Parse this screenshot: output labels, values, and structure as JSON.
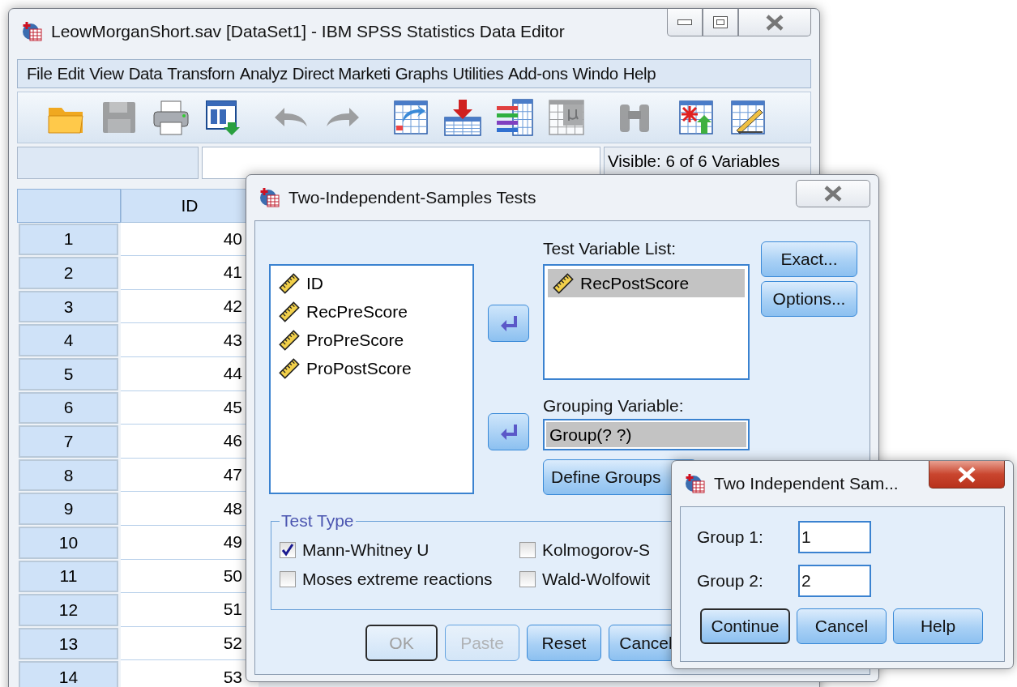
{
  "main_window": {
    "title": "LeowMorganShort.sav [DataSet1] - IBM SPSS Statistics Data Editor",
    "active": false,
    "menu": [
      "File",
      "Edit",
      "View",
      "Data",
      "Transforn",
      "Analyz",
      "Direct Marketi",
      "Graphs",
      "Utilities",
      "Add-ons",
      "Windo",
      "Help"
    ],
    "toolbar": [
      {
        "kind": "open",
        "disabled": false
      },
      {
        "kind": "save",
        "disabled": true
      },
      {
        "kind": "print",
        "disabled": false
      },
      {
        "kind": "dataview",
        "disabled": false
      },
      {
        "kind": "undo",
        "disabled": true
      },
      {
        "kind": "redo",
        "disabled": true
      },
      {
        "kind": "goto",
        "disabled": false
      },
      {
        "kind": "insert",
        "disabled": false
      },
      {
        "kind": "variables",
        "disabled": false
      },
      {
        "kind": "mu",
        "disabled": true
      },
      {
        "kind": "find",
        "disabled": true
      },
      {
        "kind": "split",
        "disabled": false
      },
      {
        "kind": "weight",
        "disabled": false
      }
    ],
    "status": "Visible: 6 of 6 Variables",
    "grid": {
      "columns": [
        "ID"
      ],
      "rows": [
        {
          "number": "1",
          "id": "40"
        },
        {
          "number": "2",
          "id": "41"
        },
        {
          "number": "3",
          "id": "42"
        },
        {
          "number": "4",
          "id": "43"
        },
        {
          "number": "5",
          "id": "44"
        },
        {
          "number": "6",
          "id": "45"
        },
        {
          "number": "7",
          "id": "46"
        },
        {
          "number": "8",
          "id": "47"
        },
        {
          "number": "9",
          "id": "48"
        },
        {
          "number": "10",
          "id": "49"
        },
        {
          "number": "11",
          "id": "50"
        },
        {
          "number": "12",
          "id": "51"
        },
        {
          "number": "13",
          "id": "52"
        },
        {
          "number": "14",
          "id": "53"
        }
      ]
    }
  },
  "dialog": {
    "title": "Two-Independent-Samples Tests",
    "active": false,
    "source_variables": [
      "ID",
      "RecPreScore",
      "ProPreScore",
      "ProPostScore"
    ],
    "test_variable_label": "Test Variable List:",
    "test_variables": [
      {
        "name": "RecPostScore",
        "selected": true
      }
    ],
    "grouping_label": "Grouping Variable:",
    "grouping_value": "Group(? ?)",
    "define_groups": "Define Groups",
    "side_buttons": [
      "Exact...",
      "Options..."
    ],
    "test_type_title": "Test Type",
    "tests": [
      {
        "label": "Mann-Whitney U",
        "checked": true
      },
      {
        "label": "Kolmogorov-S",
        "checked": false
      },
      {
        "label": "Moses extreme reactions",
        "checked": false
      },
      {
        "label": "Wald-Wolfowit",
        "checked": false
      }
    ],
    "buttons": [
      {
        "label": "OK",
        "disabled": true,
        "default": true
      },
      {
        "label": "Paste",
        "disabled": true,
        "default": false
      },
      {
        "label": "Reset",
        "disabled": false,
        "default": false
      },
      {
        "label": "Cancel",
        "disabled": false,
        "default": false
      }
    ]
  },
  "small_dialog": {
    "title": "Two Independent Sam...",
    "active": true,
    "fields": [
      {
        "label": "Group 1:",
        "value": "1"
      },
      {
        "label": "Group 2:",
        "value": "2"
      }
    ],
    "buttons": [
      {
        "label": "Continue",
        "default": true
      },
      {
        "label": "Cancel",
        "default": false
      },
      {
        "label": "Help",
        "default": false
      }
    ]
  }
}
